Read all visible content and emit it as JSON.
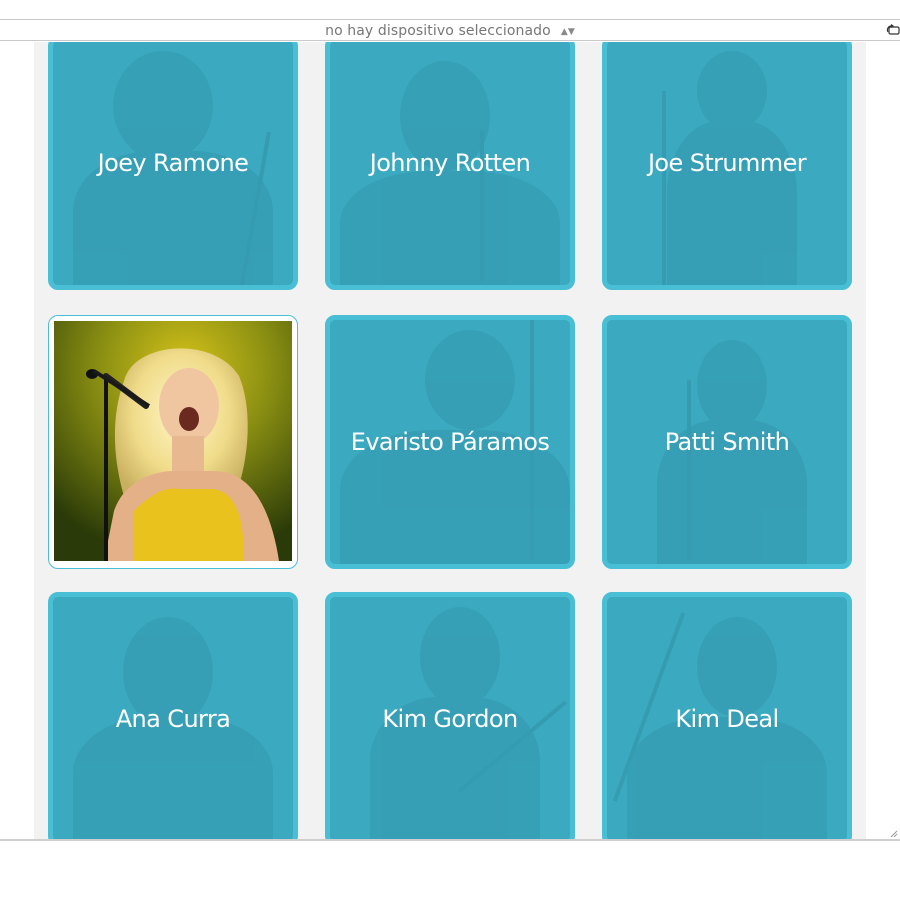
{
  "toolbar": {
    "device_label": "no hay dispositivo seleccionado",
    "device_arrows": "▲▼",
    "rotate_icon": "rotate-icon"
  },
  "colors": {
    "card_overlay": "#3ba9c0",
    "card_border": "#48bfd4",
    "viewport_bg": "#f2f2f2",
    "name_text": "#ffffff"
  },
  "grid": {
    "cards": [
      {
        "name": "Joey Ramone",
        "active": false
      },
      {
        "name": "Johnny Rotten",
        "active": false
      },
      {
        "name": "Joe Strummer",
        "active": false
      },
      {
        "name": "",
        "active": true
      },
      {
        "name": "Evaristo Páramos",
        "active": false
      },
      {
        "name": "Patti Smith",
        "active": false
      },
      {
        "name": "Ana Curra",
        "active": false
      },
      {
        "name": "Kim Gordon",
        "active": false
      },
      {
        "name": "Kim Deal",
        "active": false
      }
    ]
  }
}
